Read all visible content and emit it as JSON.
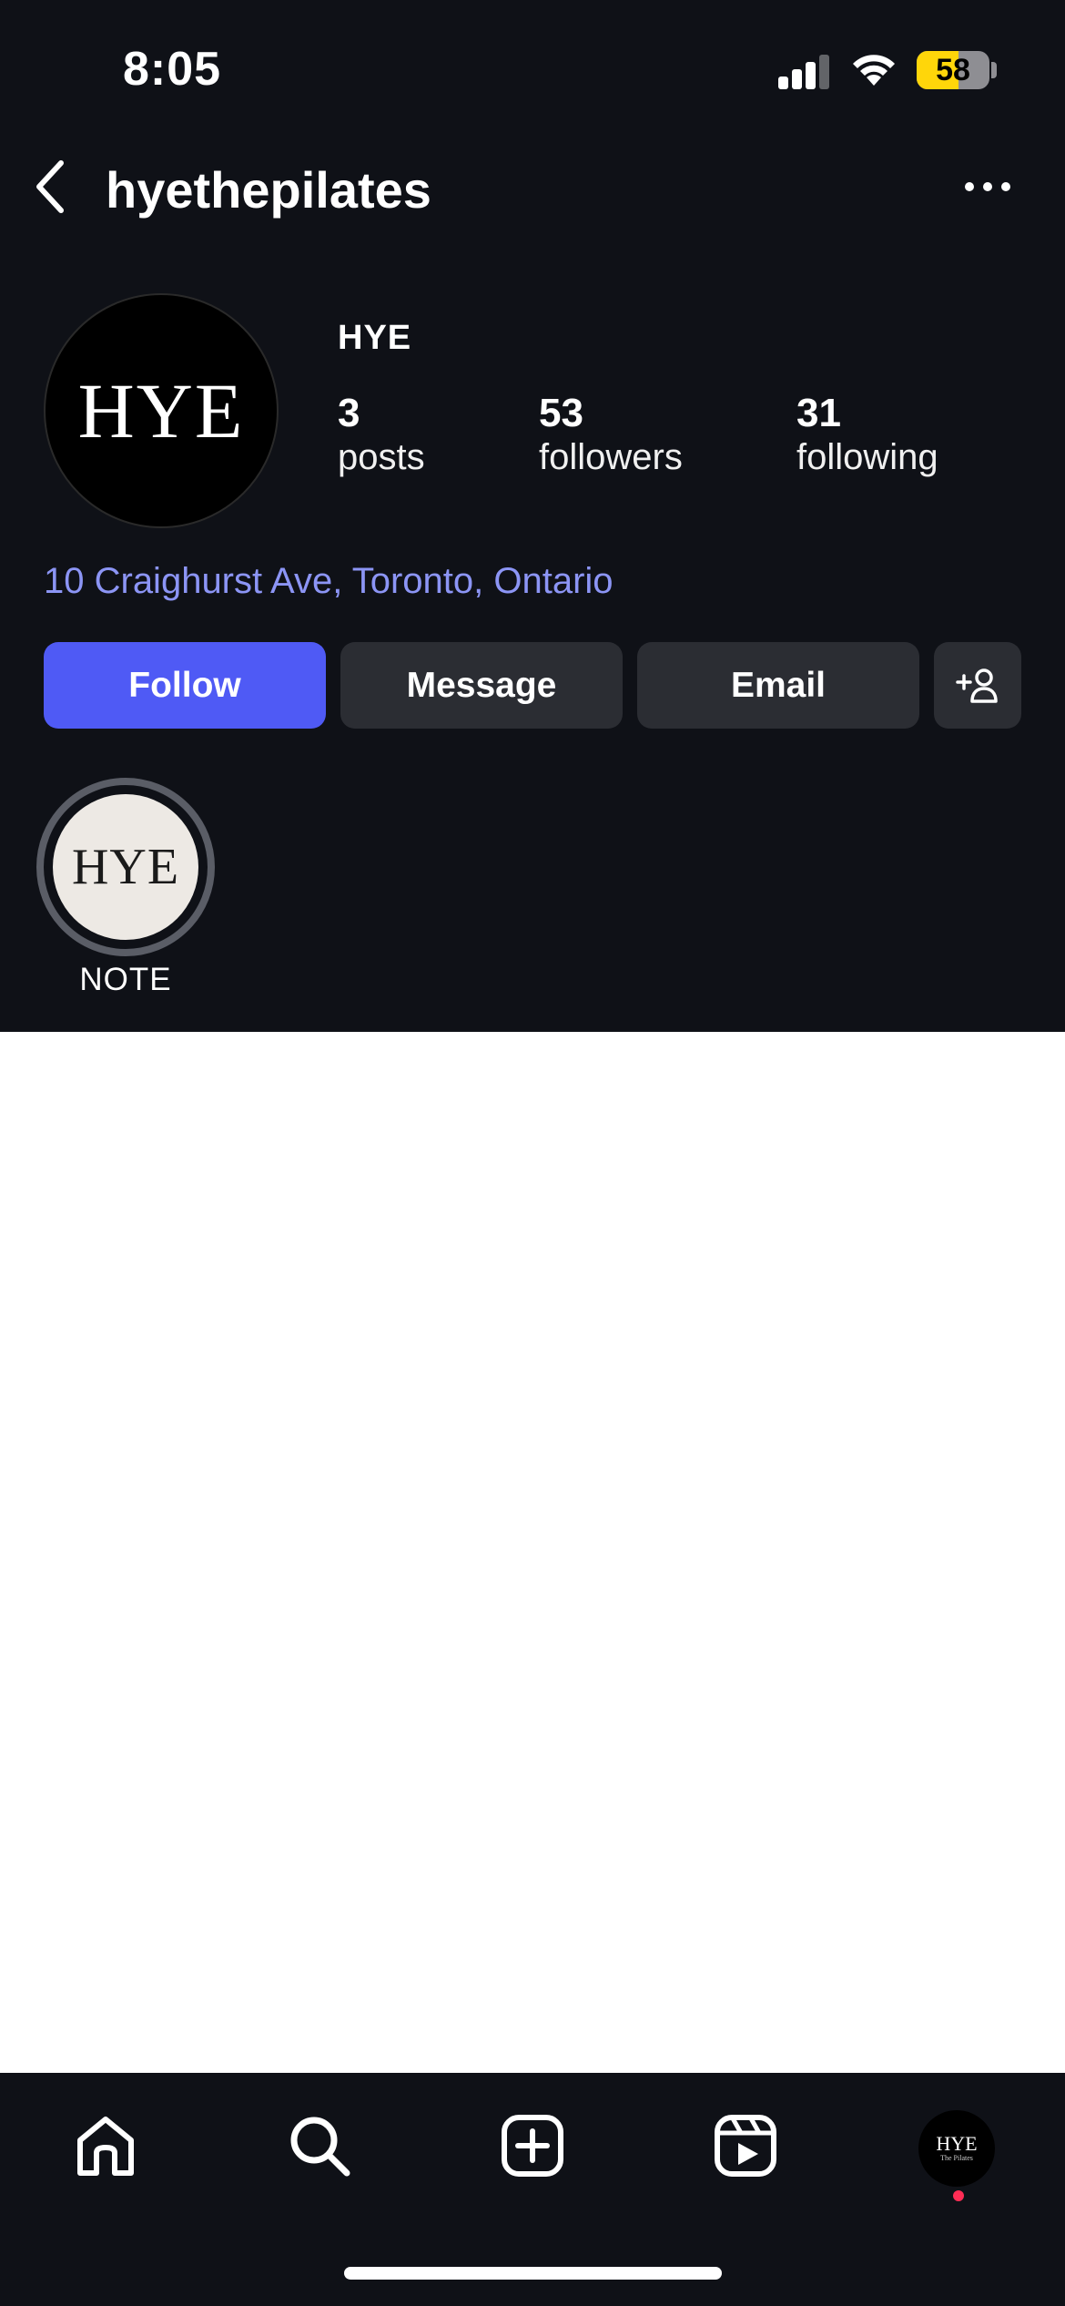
{
  "status_bar": {
    "time": "8:05",
    "battery_level": "58",
    "battery_fraction": 0.58,
    "battery_color": "#ffd60a",
    "signal_bars": 3,
    "signal_icon": "cellular-signal-icon",
    "wifi_icon": "wifi-icon"
  },
  "header": {
    "username": "hyethepilates",
    "back_icon": "chevron-left-icon",
    "more_icon": "more-horizontal-icon"
  },
  "profile": {
    "avatar_text": "HYE",
    "display_name": "HYE",
    "stats": [
      {
        "value": "3",
        "label": "posts"
      },
      {
        "value": "53",
        "label": "followers"
      },
      {
        "value": "31",
        "label": "following"
      }
    ],
    "address": "10 Craighurst Ave, Toronto, Ontario",
    "address_color": "#8c95f5"
  },
  "actions": {
    "follow": "Follow",
    "message": "Message",
    "email": "Email",
    "add_icon": "add-person-icon",
    "follow_color": "#4f5af5"
  },
  "highlights": [
    {
      "cover_text": "HYE",
      "label": "NOTE"
    }
  ],
  "tab_bar": {
    "items": [
      "home-icon",
      "search-icon",
      "create-post-icon",
      "reels-icon",
      "profile-avatar"
    ],
    "profile_avatar_text": "HYE",
    "profile_avatar_sub": "The Pilates"
  }
}
